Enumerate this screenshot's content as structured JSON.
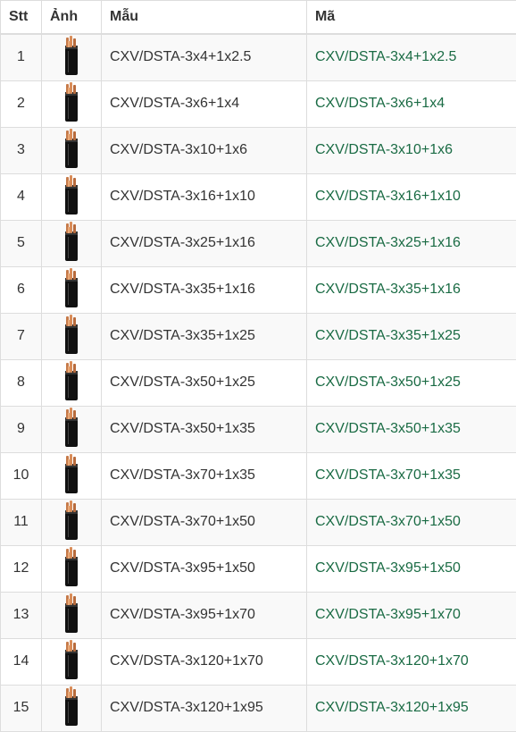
{
  "headers": {
    "stt": "Stt",
    "image": "Ảnh",
    "model": "Mẫu",
    "code": "Mã"
  },
  "colors": {
    "code_text": "#1a6b44",
    "border": "#dddddd",
    "stripe": "#f9f9f9"
  },
  "rows": [
    {
      "stt": "1",
      "model": "CXV/DSTA-3x4+1x2.5",
      "code": "CXV/DSTA-3x4+1x2.5",
      "icon": "cable-thumbnail"
    },
    {
      "stt": "2",
      "model": "CXV/DSTA-3x6+1x4",
      "code": "CXV/DSTA-3x6+1x4",
      "icon": "cable-thumbnail"
    },
    {
      "stt": "3",
      "model": "CXV/DSTA-3x10+1x6",
      "code": "CXV/DSTA-3x10+1x6",
      "icon": "cable-thumbnail"
    },
    {
      "stt": "4",
      "model": "CXV/DSTA-3x16+1x10",
      "code": "CXV/DSTA-3x16+1x10",
      "icon": "cable-thumbnail"
    },
    {
      "stt": "5",
      "model": "CXV/DSTA-3x25+1x16",
      "code": "CXV/DSTA-3x25+1x16",
      "icon": "cable-thumbnail"
    },
    {
      "stt": "6",
      "model": "CXV/DSTA-3x35+1x16",
      "code": "CXV/DSTA-3x35+1x16",
      "icon": "cable-thumbnail"
    },
    {
      "stt": "7",
      "model": "CXV/DSTA-3x35+1x25",
      "code": "CXV/DSTA-3x35+1x25",
      "icon": "cable-thumbnail"
    },
    {
      "stt": "8",
      "model": "CXV/DSTA-3x50+1x25",
      "code": "CXV/DSTA-3x50+1x25",
      "icon": "cable-thumbnail"
    },
    {
      "stt": "9",
      "model": "CXV/DSTA-3x50+1x35",
      "code": "CXV/DSTA-3x50+1x35",
      "icon": "cable-thumbnail"
    },
    {
      "stt": "10",
      "model": "CXV/DSTA-3x70+1x35",
      "code": "CXV/DSTA-3x70+1x35",
      "icon": "cable-thumbnail"
    },
    {
      "stt": "11",
      "model": "CXV/DSTA-3x70+1x50",
      "code": "CXV/DSTA-3x70+1x50",
      "icon": "cable-thumbnail"
    },
    {
      "stt": "12",
      "model": "CXV/DSTA-3x95+1x50",
      "code": "CXV/DSTA-3x95+1x50",
      "icon": "cable-thumbnail"
    },
    {
      "stt": "13",
      "model": "CXV/DSTA-3x95+1x70",
      "code": "CXV/DSTA-3x95+1x70",
      "icon": "cable-thumbnail"
    },
    {
      "stt": "14",
      "model": "CXV/DSTA-3x120+1x70",
      "code": "CXV/DSTA-3x120+1x70",
      "icon": "cable-thumbnail"
    },
    {
      "stt": "15",
      "model": "CXV/DSTA-3x120+1x95",
      "code": "CXV/DSTA-3x120+1x95",
      "icon": "cable-thumbnail"
    }
  ]
}
